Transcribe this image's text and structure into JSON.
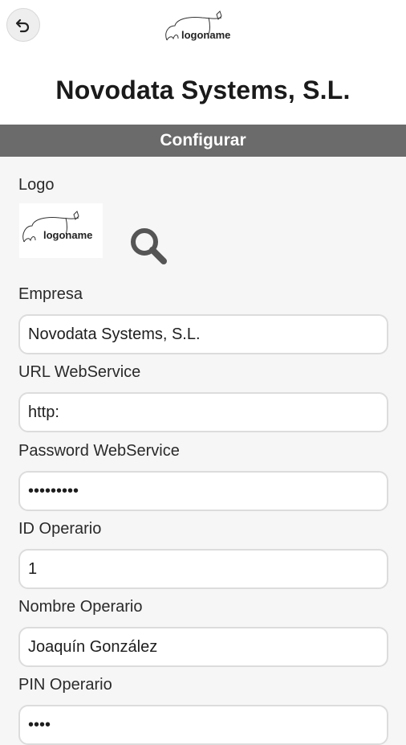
{
  "header": {
    "logo_text": "logoname",
    "company_title": "Novodata Systems, S.L."
  },
  "section": {
    "title": "Configurar"
  },
  "form": {
    "logo_label": "Logo",
    "logo_preview_text": "logoname",
    "empresa_label": "Empresa",
    "empresa_value": "Novodata Systems, S.L.",
    "url_label": "URL WebService",
    "url_value": "http:",
    "password_label": "Password WebService",
    "password_value": "123456789",
    "id_label": "ID Operario",
    "id_value": "1",
    "nombre_label": "Nombre Operario",
    "nombre_value": "Joaquín González",
    "pin_label": "PIN Operario",
    "pin_value": "1234"
  },
  "icons": {
    "back": "back-arrow-icon",
    "search": "search-icon"
  },
  "colors": {
    "section_bar": "#6b6b6b",
    "background": "#f6f6f6",
    "topbar": "#ffffff"
  }
}
